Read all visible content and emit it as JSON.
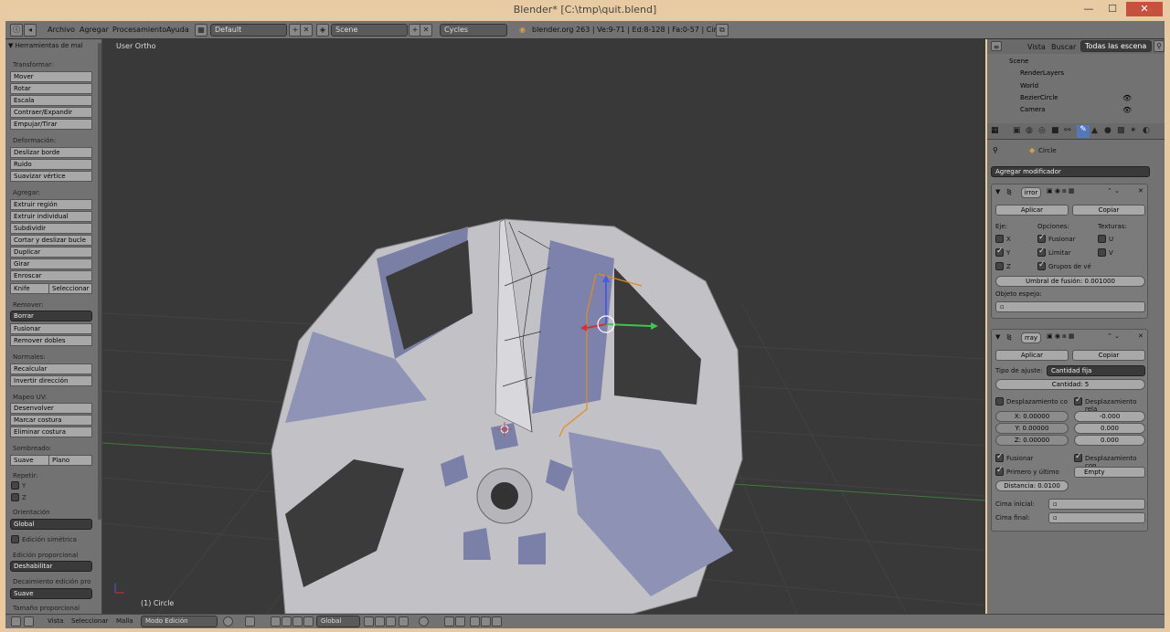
{
  "window": {
    "title": "Blender* [C:\\tmp\\quit.blend]",
    "minimize": "—",
    "maximize": "☐",
    "close": "✕"
  },
  "menubar": {
    "items": [
      "Archivo",
      "Agregar",
      "Procesamiento",
      "Ayuda"
    ],
    "layout": "Default",
    "scene": "Scene",
    "engine": "Cycles",
    "stats": "blender.org 263 | Ve:9-71 | Ed:8-128 | Fa:0-57 | Circle"
  },
  "toolshelf": {
    "header": "Herramientas de mal",
    "transform_label": "Transformar:",
    "transform": [
      "Mover",
      "Rotar",
      "Escala",
      "Contraer/Expandir",
      "Empujar/Tirar"
    ],
    "deform_label": "Deformación:",
    "deform": [
      "Deslizar borde",
      "Ruido",
      "Suavizar vértice"
    ],
    "add_label": "Agregar:",
    "add": [
      "Extruir región",
      "Extruir individual",
      "Subdividir",
      "Cortar y deslizar bucle",
      "Duplicar",
      "Girar",
      "Enroscar"
    ],
    "knife": "Knife",
    "select": "Seleccionar",
    "remove_label": "Remover:",
    "borrar": "Borrar",
    "fusionar": "Fusionar",
    "remover_dobles": "Remover dobles",
    "normals_label": "Normales:",
    "recalcular": "Recalcular",
    "invertir": "Invertir dirección",
    "uv_label": "Mapeo UV:",
    "desenvolver": "Desenvolver",
    "marcar": "Marcar costura",
    "eliminar": "Eliminar costura",
    "shading_label": "Sombreado:",
    "suave": "Suave",
    "plano": "Plano",
    "repeat_label": "Repetir:",
    "repeat_y": "Y",
    "repeat_z": "Z",
    "orientation_label": "Orientación",
    "orientation": "Global",
    "sym_edit": "Edición simétrica",
    "prop_edit_label": "Edición proporcional",
    "prop_edit": "Deshabilitar",
    "falloff_label": "Decaimiento edición pro",
    "falloff": "Suave",
    "prop_size_label": "Tamaño proporcional"
  },
  "viewport": {
    "view_label": "User Ortho",
    "object_label": "(1) Circle"
  },
  "outliner": {
    "view": "Vista",
    "search": "Buscar",
    "filter": "Todas las escena",
    "items": [
      "Scene",
      "RenderLayers",
      "World",
      "BezierCircle",
      "Camera"
    ]
  },
  "properties": {
    "object": "Circle",
    "add_modifier": "Agregar modificador",
    "mirror": {
      "name": "irror",
      "apply": "Aplicar",
      "copy": "Copiar",
      "axis_label": "Eje:",
      "options_label": "Opciones:",
      "textures_label": "Texturas:",
      "x": "X",
      "y": "Y",
      "z": "Z",
      "merge": "Fusionar",
      "clip": "Limitar",
      "vgroups": "Grupos de vé",
      "u": "U",
      "v": "V",
      "threshold": "Umbral de fusión: 0.001000",
      "mirror_obj": "Objeto espejo:"
    },
    "array": {
      "name": "rray",
      "apply": "Aplicar",
      "copy": "Copiar",
      "fit_label": "Tipo de ajuste:",
      "fit": "Cantidad fija",
      "count": "Cantidad: 5",
      "const_offset": "Desplazamiento co",
      "rel_offset": "Desplazamiento rela",
      "cx": "X: 0.00000",
      "cy": "Y: 0.00000",
      "cz": "Z: 0.00000",
      "rx": "-0.000",
      "ry": "0.000",
      "rz": "0.000",
      "merge": "Fusionar",
      "first_last": "Primero y último",
      "obj_offset": "Desplazamiento con",
      "empty": "Empty",
      "distance": "Distancia: 0.0100",
      "start_cap": "Cima inicial:",
      "end_cap": "Cima final:"
    }
  },
  "footer": {
    "items": [
      "Vista",
      "Seleccionar",
      "Malla"
    ],
    "mode": "Modo Edición",
    "orientation": "Global"
  }
}
